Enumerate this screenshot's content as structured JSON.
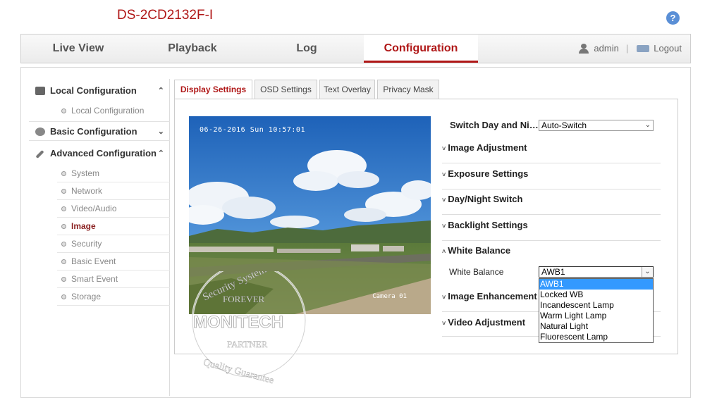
{
  "device_title": "DS-2CD2132F-I",
  "help_icon": "?",
  "nav": {
    "tabs": [
      "Live View",
      "Playback",
      "Log",
      "Configuration"
    ],
    "active_tab": "Configuration",
    "user": "admin",
    "separator": "|",
    "logout": "Logout"
  },
  "sidebar": {
    "local_configuration": "Local Configuration",
    "local_configuration_items": [
      "Local Configuration"
    ],
    "basic_configuration": "Basic Configuration",
    "advanced_configuration": "Advanced Configuration",
    "advanced_items": [
      "System",
      "Network",
      "Video/Audio",
      "Image",
      "Security",
      "Basic Event",
      "Smart Event",
      "Storage"
    ],
    "active_item": "Image"
  },
  "subtabs": [
    "Display Settings",
    "OSD Settings",
    "Text Overlay",
    "Privacy Mask"
  ],
  "active_subtab": "Display Settings",
  "preview": {
    "osd_time": "06-26-2016 Sun 10:57:01",
    "osd_camera": "Camera 01"
  },
  "watermark": {
    "ring_text": "Security System",
    "forever": "FOREVER",
    "brand": "MONITECH",
    "partner": "PARTNER",
    "bottom_text": "Quality Guarantee"
  },
  "settings": {
    "switch_day_night_label": "Switch Day and Ni…",
    "switch_day_night_value": "Auto-Switch",
    "sections": [
      "Image Adjustment",
      "Exposure Settings",
      "Day/Night Switch",
      "Backlight Settings",
      "White Balance",
      "Image Enhancement",
      "Video Adjustment"
    ],
    "white_balance_label": "White Balance",
    "white_balance_value": "AWB1",
    "white_balance_options": [
      "AWB1",
      "Locked WB",
      "Incandescent Lamp",
      "Warm Light Lamp",
      "Natural Light",
      "Fluorescent Lamp"
    ]
  },
  "colors": {
    "accent_red": "#b01818",
    "selection_blue": "#3399ff"
  },
  "icons": [
    "help-icon",
    "user-icon",
    "logout-icon",
    "local-config-icon",
    "basic-config-icon",
    "advanced-config-icon",
    "chevron-up-icon",
    "chevron-down-icon"
  ]
}
